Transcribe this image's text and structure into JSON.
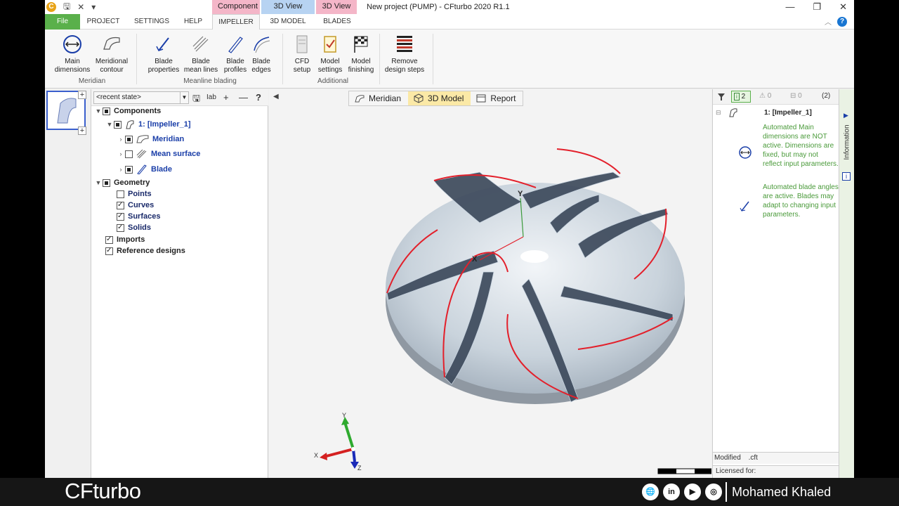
{
  "app": {
    "logo_letter": "C",
    "window_title": "New project (PUMP) - CFturbo 2020 R1.1",
    "context_tabs": [
      {
        "label": "Component",
        "color": "#f4b6c8"
      },
      {
        "label": "3D View",
        "color": "#b7d3f2"
      },
      {
        "label": "3D View",
        "color": "#f4b6c8"
      }
    ]
  },
  "tabs": {
    "file": "File",
    "project": "PROJECT",
    "settings": "SETTINGS",
    "help": "HELP",
    "impeller": "IMPELLER",
    "model3d": "3D MODEL",
    "blades": "BLADES"
  },
  "ribbon": {
    "main_dimensions": "Main dimensions",
    "meridional_contour": "Meridional contour",
    "group_meridian": "Meridian",
    "blade_properties": "Blade properties",
    "blade_mean_lines": "Blade mean lines",
    "blade_profiles": "Blade profiles",
    "blade_edges": "Blade edges",
    "group_meanline": "Meanline blading",
    "cfd_setup": "CFD setup",
    "model_settings": "Model settings",
    "model_finishing": "Model finishing",
    "remove_design_steps": "Remove design steps",
    "group_additional": "Additional"
  },
  "tree": {
    "recent_state": "<recent state>",
    "components": "Components",
    "impeller": "1: [Impeller_1]",
    "meridian": "Meridian",
    "mean_surface": "Mean surface",
    "blade": "Blade",
    "geometry": "Geometry",
    "points": "Points",
    "curves": "Curves",
    "surfaces": "Surfaces",
    "solids": "Solids",
    "imports": "Imports",
    "reference_designs": "Reference designs"
  },
  "viewer": {
    "tabs": [
      "Meridian",
      "3D Model",
      "Report"
    ],
    "active_tab": "3D Model",
    "axis_y": "Y",
    "axis_x": "X",
    "axis_z": "Z"
  },
  "info_panel": {
    "info_count": "2",
    "warn_count": "0",
    "err_count": "0",
    "total": "(2)",
    "item_title": "1: [Impeller_1]",
    "msg1": "Automated Main dimensions are NOT active. Dimensions are fixed, but may not reflect input parameters.",
    "msg2": "Automated blade angles are active. Blades may adapt to changing input parameters.",
    "status_modified": "Modified",
    "status_ext": ".cft",
    "status_licensed": "Licensed for:",
    "side_label": "Information"
  },
  "footer": {
    "brand": "CFturbo",
    "author": "Mohamed Khaled",
    "socials": [
      "web-icon",
      "linkedin-icon",
      "youtube-icon",
      "instagram-icon"
    ]
  }
}
